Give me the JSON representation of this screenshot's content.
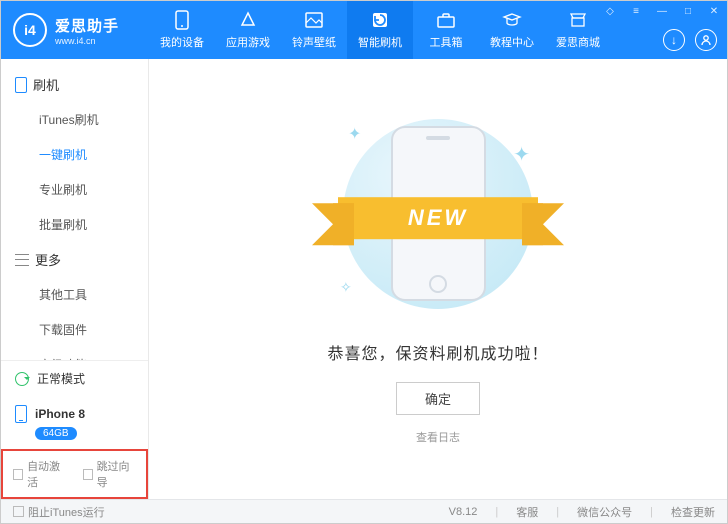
{
  "brand": {
    "name": "爱思助手",
    "url": "www.i4.cn",
    "logo_text": "i4"
  },
  "nav": [
    {
      "label": "我的设备"
    },
    {
      "label": "应用游戏"
    },
    {
      "label": "铃声壁纸"
    },
    {
      "label": "智能刷机"
    },
    {
      "label": "工具箱"
    },
    {
      "label": "教程中心"
    },
    {
      "label": "爱思商城"
    }
  ],
  "sidebar": {
    "section1": {
      "title": "刷机",
      "items": [
        "iTunes刷机",
        "一键刷机",
        "专业刷机",
        "批量刷机"
      ]
    },
    "section2": {
      "title": "更多",
      "items": [
        "其他工具",
        "下载固件",
        "高级功能"
      ]
    },
    "mode": "正常模式",
    "device": {
      "name": "iPhone 8",
      "storage": "64GB"
    },
    "check1": "自动激活",
    "check2": "跳过向导"
  },
  "main": {
    "ribbon": "NEW",
    "success": "恭喜您，保资料刷机成功啦！",
    "ok": "确定",
    "view_log": "查看日志"
  },
  "footer": {
    "block_itunes": "阻止iTunes运行",
    "version": "V8.12",
    "support": "客服",
    "wechat": "微信公众号",
    "update": "检查更新"
  }
}
